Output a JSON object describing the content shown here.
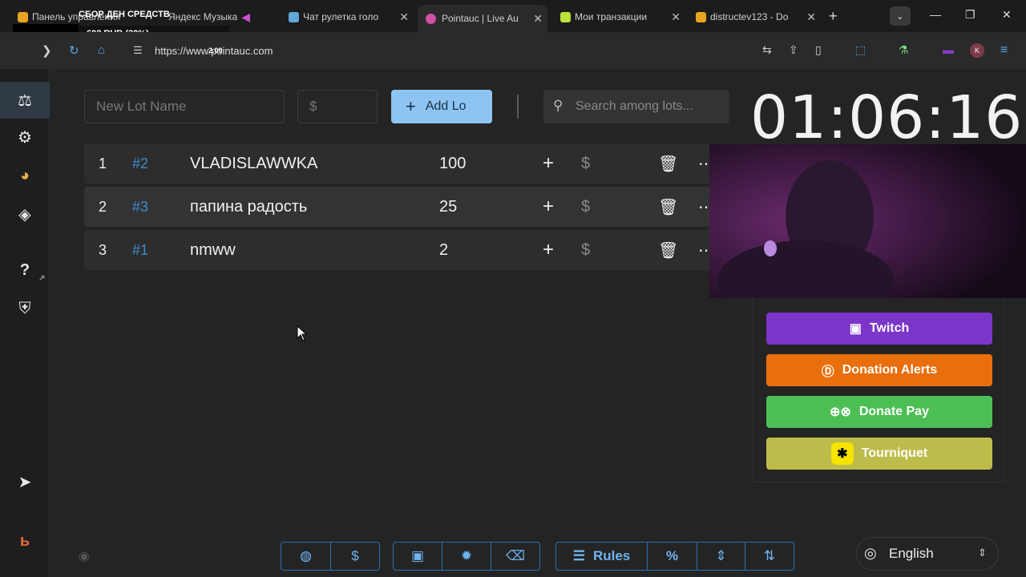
{
  "browser": {
    "tabs": [
      {
        "title": "Панель управления",
        "favicon_color": "#e8a321",
        "active": false
      },
      {
        "title": "Яндекс Музыка",
        "favicon_color": "#d04ed6",
        "active": false
      },
      {
        "title": "Чат рулетка голо",
        "favicon_color": "#5fa8d8",
        "active": false
      },
      {
        "title": "Pointauc | Live Au",
        "favicon_color": "#d14fa4",
        "active": true
      },
      {
        "title": "Мои транзакции",
        "favicon_color": "#b9e23a",
        "active": false
      },
      {
        "title": "distructev123 - Do",
        "favicon_color": "#e8a321",
        "active": false
      }
    ],
    "new_tab": "+",
    "url": "https://www.pointauc.com",
    "url_overlay": "2.00",
    "profile_initial": "K"
  },
  "overlay": {
    "banner": "СБОР ДЕН СРЕДСТВ",
    "amount": "602 RUB (30%)"
  },
  "sidebar": {
    "items": [
      {
        "icon": "gavel-icon",
        "glyph": "⚖",
        "active": true
      },
      {
        "icon": "gear-icon",
        "glyph": "⚙",
        "active": false
      },
      {
        "icon": "wheel-icon",
        "glyph": "◕",
        "active": false
      },
      {
        "icon": "layers-icon",
        "glyph": "◈",
        "active": false
      },
      {
        "icon": "help-icon",
        "glyph": "?",
        "active": false
      },
      {
        "icon": "shield-icon",
        "glyph": "⛨",
        "active": false
      },
      {
        "icon": "telegram-icon",
        "glyph": "➤",
        "active": false
      },
      {
        "icon": "brand-icon",
        "glyph": "ь",
        "active": false
      }
    ]
  },
  "toolbar": {
    "lot_name_placeholder": "New Lot Name",
    "amount_placeholder": "$",
    "add_label": "Add Lo",
    "search_placeholder": "Search among lots..."
  },
  "timer": "01:06:16",
  "lots": [
    {
      "rank": "1",
      "id": "#2",
      "name": "VLADISLAWWKA",
      "amount": "100"
    },
    {
      "rank": "2",
      "id": "#3",
      "name": "папина радость",
      "amount": "25"
    },
    {
      "rank": "3",
      "id": "#1",
      "name": "nmww",
      "amount": "2"
    }
  ],
  "integrations": [
    {
      "label": "Twitch",
      "color": "#7b35c9",
      "icon": "twitch-icon"
    },
    {
      "label": "Donation Alerts",
      "color": "#e86f0c",
      "icon": "donation-alerts-icon"
    },
    {
      "label": "Donate Pay",
      "color": "#4cbf54",
      "icon": "gamepad-icon"
    },
    {
      "label": "Tourniquet",
      "color": "#bdbc4b",
      "icon": "tourniquet-icon"
    }
  ],
  "bottom_bar": {
    "rules_label": "Rules",
    "percent_label": "%"
  },
  "language": "English"
}
